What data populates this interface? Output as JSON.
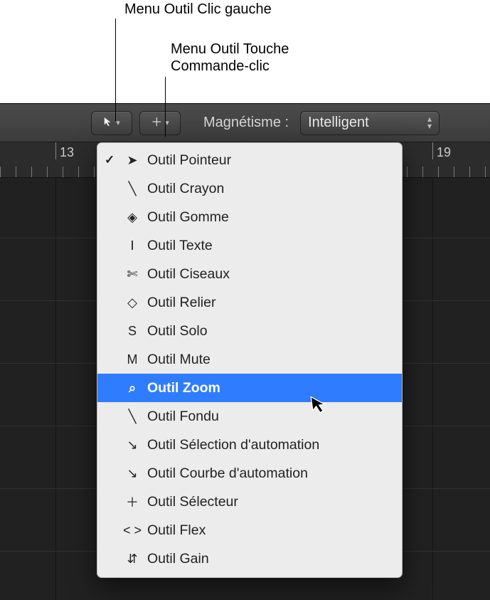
{
  "annotations": {
    "left_menu": "Menu Outil Clic gauche",
    "cmd_menu_line1": "Menu Outil Touche",
    "cmd_menu_line2": "Commande-clic"
  },
  "toolbar": {
    "left_tool_icon": "pointer-icon",
    "cmd_tool_icon": "plus-icon",
    "magnetism_label": "Magnétisme :",
    "magnetism_value": "Intelligent"
  },
  "ruler": {
    "labels": [
      "13",
      "19"
    ]
  },
  "menu": {
    "selected_index": 8,
    "checked_index": 0,
    "items": [
      {
        "icon": "pointer",
        "label": "Outil Pointeur"
      },
      {
        "icon": "pencil",
        "label": "Outil Crayon"
      },
      {
        "icon": "eraser",
        "label": "Outil Gomme"
      },
      {
        "icon": "text-cursor",
        "label": "Outil Texte"
      },
      {
        "icon": "scissors",
        "label": "Outil Ciseaux"
      },
      {
        "icon": "glue",
        "label": "Outil Relier"
      },
      {
        "icon": "solo",
        "label": "Outil Solo"
      },
      {
        "icon": "mute",
        "label": "Outil Mute"
      },
      {
        "icon": "zoom",
        "label": "Outil Zoom"
      },
      {
        "icon": "fade",
        "label": "Outil Fondu"
      },
      {
        "icon": "automation-select",
        "label": "Outil Sélection d'automation"
      },
      {
        "icon": "automation-curve",
        "label": "Outil Courbe d'automation"
      },
      {
        "icon": "marquee",
        "label": "Outil Sélecteur"
      },
      {
        "icon": "flex",
        "label": "Outil Flex"
      },
      {
        "icon": "gain",
        "label": "Outil Gain"
      }
    ]
  },
  "icon_glyphs": {
    "pointer": "➤",
    "pencil": "╲",
    "eraser": "◈",
    "text-cursor": "Ⅰ",
    "scissors": "✄",
    "glue": "◇",
    "solo": "S",
    "mute": "M",
    "zoom": "⌕",
    "fade": "╲",
    "automation-select": "↘",
    "automation-curve": "↘",
    "marquee": "＋",
    "flex": "< >",
    "gain": "⇵"
  }
}
